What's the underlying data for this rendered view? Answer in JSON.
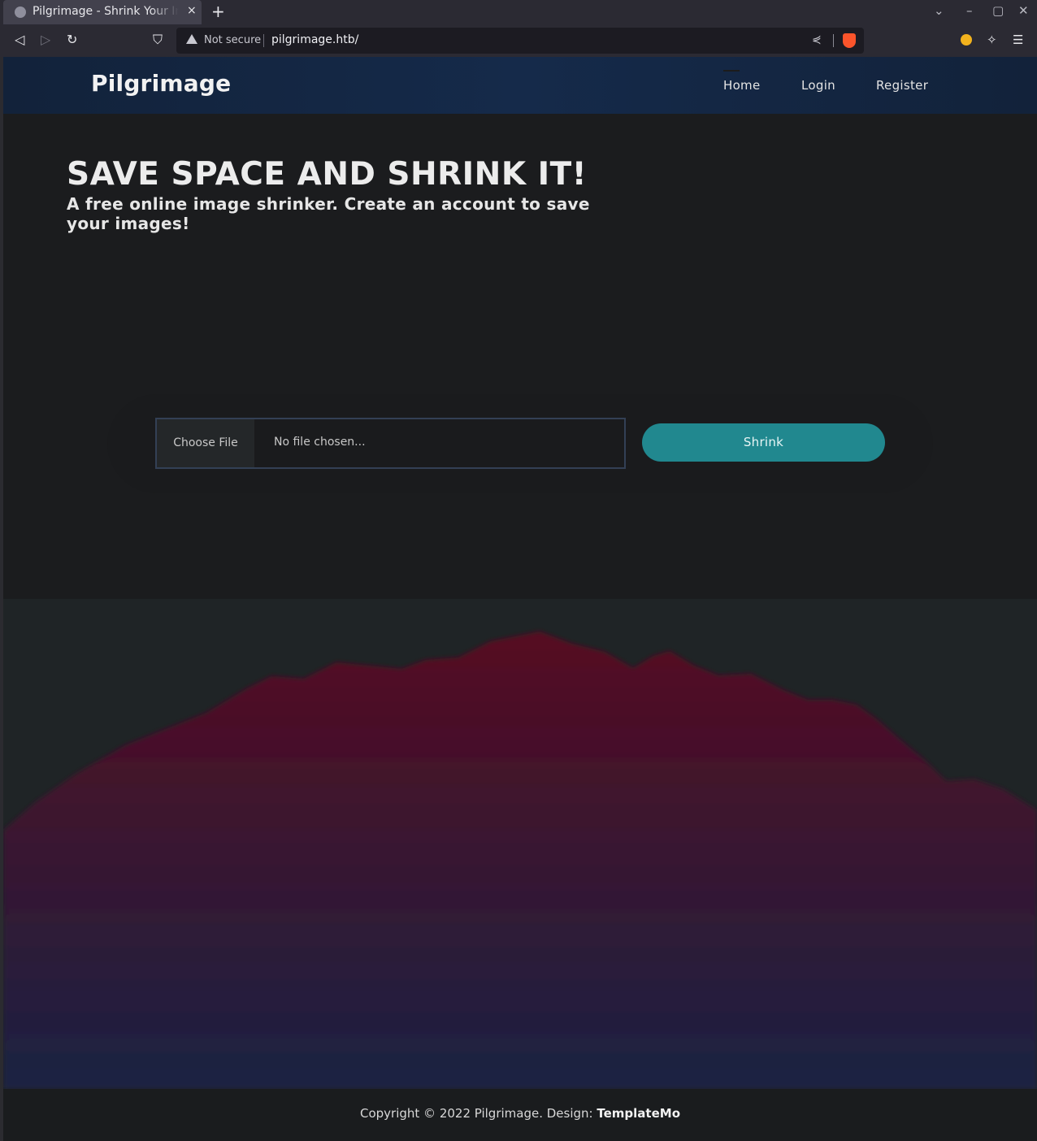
{
  "browser": {
    "tab_title": "Pilgrimage - Shrink Your Images",
    "tab_close": "×",
    "new_tab": "+",
    "url_security": "Not secure",
    "url": "pilgrimage.htb/",
    "icons": [
      "globe-icon",
      "back-icon",
      "forward-icon",
      "reload-icon",
      "bookmark-icon",
      "warning-icon",
      "share-icon",
      "brave-shield-icon",
      "extensions-icon",
      "menu-icon"
    ]
  },
  "header": {
    "logo": "Pilgrimage",
    "nav": [
      {
        "label": "Home"
      },
      {
        "label": "Login"
      },
      {
        "label": "Register"
      }
    ]
  },
  "hero": {
    "title": "SAVE SPACE AND SHRINK IT!",
    "subtitle": "A free online image shrinker. Create an account to save your images!"
  },
  "upload": {
    "choose_label": "Choose File",
    "file_status": "No file chosen...",
    "submit_label": "Shrink"
  },
  "footer": {
    "copyright": "Copyright © 2022 Pilgrimage. Design: ",
    "design_link": "TemplateMo"
  },
  "colors": {
    "header_bg": "#152a4a",
    "accent": "#21888f",
    "mountain_top": "#520b22",
    "mountain_bottom": "#1c2242"
  }
}
